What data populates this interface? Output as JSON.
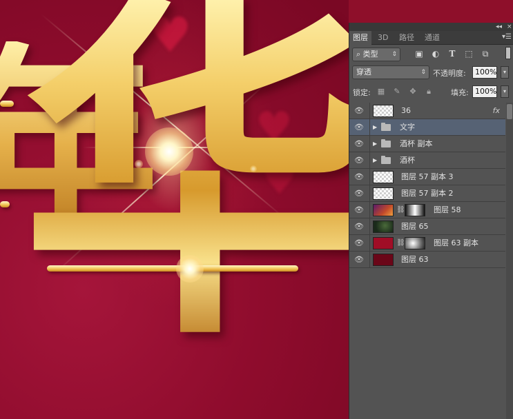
{
  "canvas": {
    "artwork_glyph": "华",
    "artwork_glyph_left": "年"
  },
  "panel": {
    "collapse_icon": "double-chevron-left-icon",
    "close_label": "×",
    "tabs": [
      {
        "label": "图层",
        "active": true
      },
      {
        "label": "3D",
        "active": false
      },
      {
        "label": "路径",
        "active": false
      },
      {
        "label": "通道",
        "active": false
      }
    ],
    "menu_icon": "panel-menu-icon",
    "filter": {
      "kind_label": "类型",
      "icons": [
        "pixel-filter-icon",
        "adjustment-filter-icon",
        "type-filter-icon",
        "shape-filter-icon",
        "smart-object-filter-icon"
      ]
    },
    "blend_mode": "穿透",
    "opacity_label": "不透明度:",
    "opacity_value": "100%",
    "lock_label": "锁定:",
    "lock_icons": [
      "lock-transparent-icon",
      "lock-image-icon",
      "lock-position-icon",
      "lock-all-icon"
    ],
    "fill_label": "填充:",
    "fill_value": "100%",
    "accent_selected": "#566274",
    "layers": [
      {
        "name": "36",
        "type": "smart",
        "fx": "fx"
      },
      {
        "name": "文字",
        "type": "group",
        "selected": true
      },
      {
        "name": "酒杯 副本",
        "type": "group"
      },
      {
        "name": "酒杯",
        "type": "group"
      },
      {
        "name": "图层 57 副本 3",
        "type": "transparent"
      },
      {
        "name": "图层 57 副本 2",
        "type": "transparent"
      },
      {
        "name": "图层 58",
        "type": "image-mask"
      },
      {
        "name": "图层 65",
        "type": "image"
      },
      {
        "name": "图层 63 副本",
        "type": "red-mask"
      },
      {
        "name": "图层 63",
        "type": "dark-red"
      }
    ]
  }
}
